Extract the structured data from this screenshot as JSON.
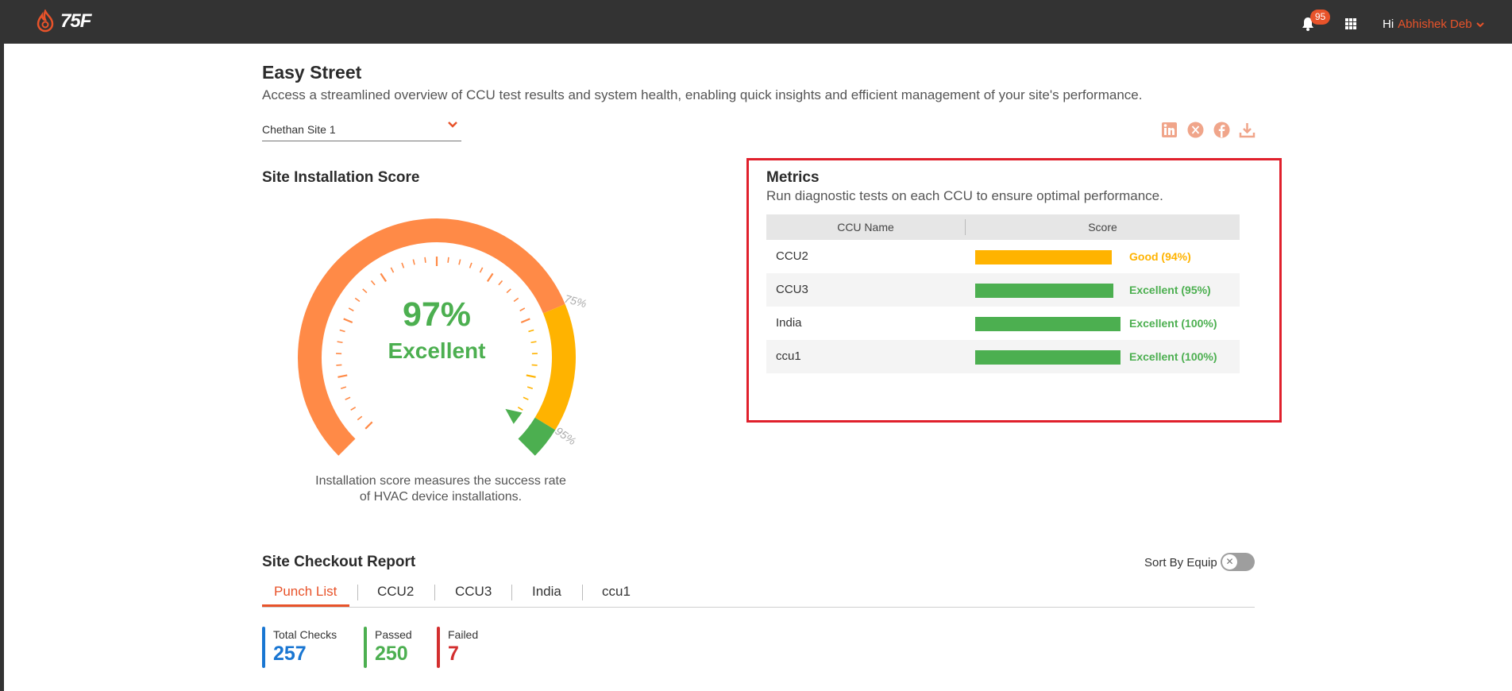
{
  "header": {
    "logo_text": "75F",
    "notification_count": "95",
    "greeting": "Hi",
    "user_name": "Abhishek Deb"
  },
  "page": {
    "title": "Easy Street",
    "subtitle": "Access a streamlined overview of CCU test results and system health, enabling quick insights and efficient management of your site's performance.",
    "site_select": "Chethan Site 1"
  },
  "installation": {
    "title": "Site Installation Score",
    "score": "97%",
    "rating": "Excellent",
    "score_value": 97,
    "marker_75": "75%",
    "marker_95": "95%",
    "description_line1": "Installation score measures the success rate",
    "description_line2": "of HVAC device installations."
  },
  "metrics": {
    "title": "Metrics",
    "subtitle": "Run diagnostic tests on each CCU to ensure optimal performance.",
    "col_name": "CCU Name",
    "col_score": "Score",
    "rows": [
      {
        "name": "CCU2",
        "score_text": "Good (94%)",
        "percent": 94,
        "color": "#ffb300"
      },
      {
        "name": "CCU3",
        "score_text": "Excellent (95%)",
        "percent": 95,
        "color": "#4caf50"
      },
      {
        "name": "India",
        "score_text": "Excellent (100%)",
        "percent": 100,
        "color": "#4caf50"
      },
      {
        "name": "ccu1",
        "score_text": "Excellent (100%)",
        "percent": 100,
        "color": "#4caf50"
      }
    ]
  },
  "checkout": {
    "title": "Site Checkout Report",
    "sort_label": "Sort By Equip",
    "tabs": [
      "Punch List",
      "CCU2",
      "CCU3",
      "India",
      "ccu1"
    ],
    "stats": {
      "total_label": "Total Checks",
      "total_value": "257",
      "passed_label": "Passed",
      "passed_value": "250",
      "failed_label": "Failed",
      "failed_value": "7"
    }
  },
  "colors": {
    "accent": "#e8532a",
    "green": "#4caf50",
    "amber": "#ffb300",
    "orange_arc": "#ff8a47",
    "blue": "#1976d2",
    "red": "#d32f2f"
  }
}
